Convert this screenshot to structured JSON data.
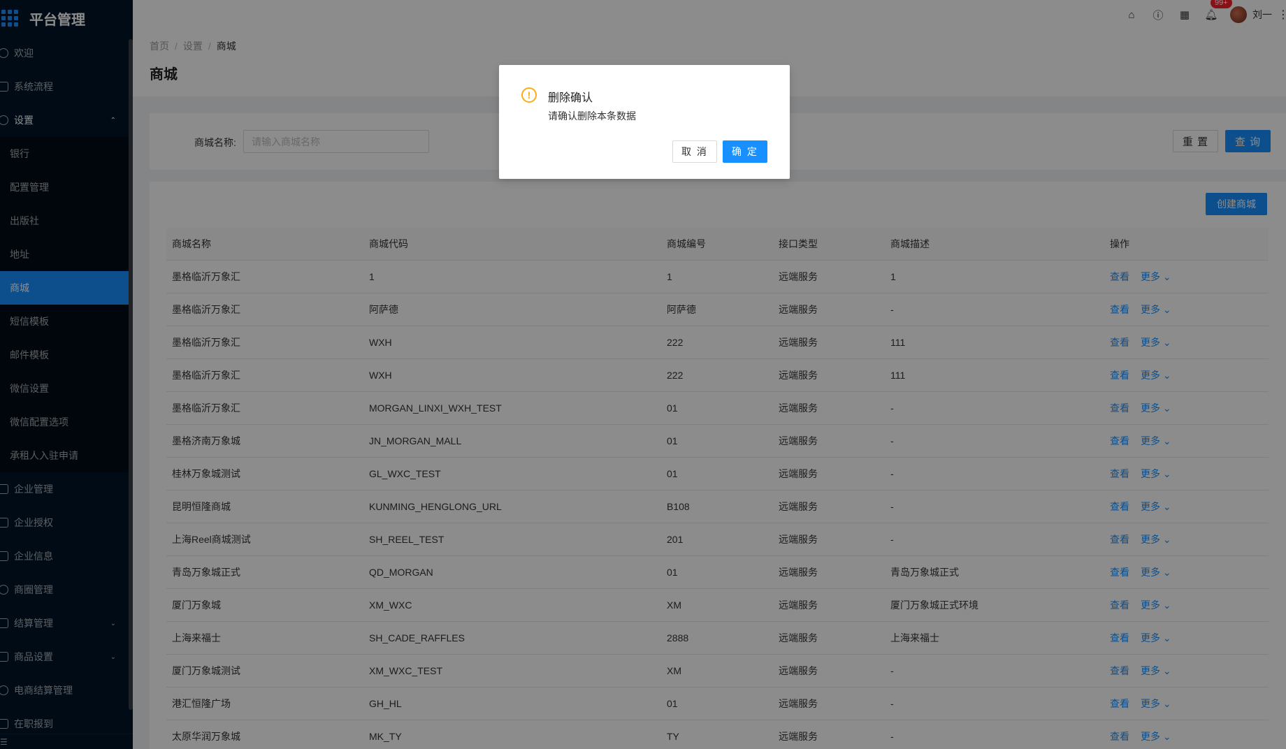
{
  "app": {
    "title": "平台管理"
  },
  "sidebar": {
    "items": [
      {
        "label": "欢迎",
        "icon": "smile-icon"
      },
      {
        "label": "系统流程",
        "icon": "mail-icon"
      },
      {
        "label": "设置",
        "icon": "gear-icon"
      }
    ],
    "settings_sub": [
      "银行",
      "配置管理",
      "出版社",
      "地址",
      "商城",
      "短信模板",
      "邮件模板",
      "微信设置",
      "微信配置选项",
      "承租人入驻申请"
    ],
    "lower": [
      {
        "label": "企业管理",
        "icon": "mail-icon"
      },
      {
        "label": "企业授权",
        "icon": "mail-icon"
      },
      {
        "label": "企业信息",
        "icon": "mail-icon"
      },
      {
        "label": "商圈管理",
        "icon": "compass-icon"
      },
      {
        "label": "结算管理",
        "icon": "calendar-icon"
      },
      {
        "label": "商品设置",
        "icon": "appstore-icon"
      },
      {
        "label": "电商结算管理",
        "icon": "clock-icon"
      },
      {
        "label": "在职报到",
        "icon": "mail-icon"
      }
    ],
    "collapse_icon": "menu-fold-icon"
  },
  "header": {
    "icons": [
      "home-icon",
      "question-icon",
      "appstore-icon",
      "bell-icon"
    ],
    "badge": "99+",
    "user_name": "刘一"
  },
  "breadcrumb": {
    "home": "首页",
    "settings": "设置",
    "current": "商城",
    "sep": "/"
  },
  "page_title": "商城",
  "search": {
    "label": "商城名称:",
    "placeholder": "请输入商城名称",
    "reset": "重 置",
    "query": "查 询"
  },
  "create_button": "创建商城",
  "table": {
    "headers": [
      "商城名称",
      "商城代码",
      "商城编号",
      "接口类型",
      "商城描述",
      "操作"
    ],
    "rows": [
      [
        "墨格临沂万象汇",
        "1",
        "1",
        "远端服务",
        "1"
      ],
      [
        "墨格临沂万象汇",
        "阿萨德",
        "阿萨德",
        "远端服务",
        "-"
      ],
      [
        "墨格临沂万象汇",
        "WXH",
        "222",
        "远端服务",
        "111"
      ],
      [
        "墨格临沂万象汇",
        "WXH",
        "222",
        "远端服务",
        "111"
      ],
      [
        "墨格临沂万象汇",
        "MORGAN_LINXI_WXH_TEST",
        "01",
        "远端服务",
        "-"
      ],
      [
        "墨格济南万象城",
        "JN_MORGAN_MALL",
        "01",
        "远端服务",
        "-"
      ],
      [
        "桂林万象城测试",
        "GL_WXC_TEST",
        "01",
        "远端服务",
        "-"
      ],
      [
        "昆明恒隆商城",
        "KUNMING_HENGLONG_URL",
        "B108",
        "远端服务",
        "-"
      ],
      [
        "上海Reel商城测试",
        "SH_REEL_TEST",
        "201",
        "远端服务",
        "-"
      ],
      [
        "青岛万象城正式",
        "QD_MORGAN",
        "01",
        "远端服务",
        "青岛万象城正式"
      ],
      [
        "厦门万象城",
        "XM_WXC",
        "XM",
        "远端服务",
        "厦门万象城正式环境"
      ],
      [
        "上海来福士",
        "SH_CADE_RAFFLES",
        "2888",
        "远端服务",
        "上海来福士"
      ],
      [
        "厦门万象城测试",
        "XM_WXC_TEST",
        "XM",
        "远端服务",
        "-"
      ],
      [
        "港汇恒隆广场",
        "GH_HL",
        "01",
        "远端服务",
        "-"
      ],
      [
        "太原华润万象城",
        "MK_TY",
        "TY",
        "远端服务",
        "-"
      ]
    ],
    "action_view": "查看",
    "action_more": "更多"
  },
  "modal": {
    "title": "删除确认",
    "content": "请确认删除本条数据",
    "cancel": "取 消",
    "ok": "确 定",
    "icon": "exclamation-circle-icon"
  },
  "colors": {
    "primary": "#1890ff",
    "sidebar": "#001529",
    "warning": "#faad14"
  }
}
